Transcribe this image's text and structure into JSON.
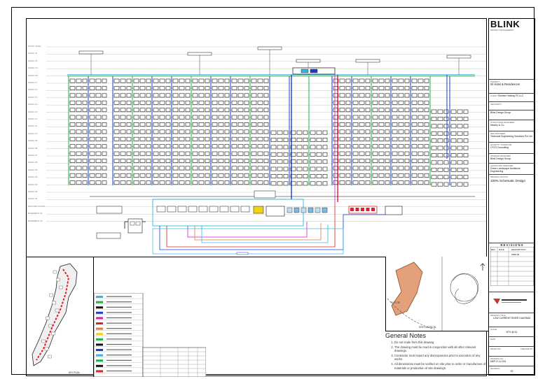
{
  "title_block": {
    "logo": "BLINK",
    "logo_sub": "PROJECT MANAGEMENT",
    "project_label": "PROJECT",
    "project_name": "W Hotel & Residences",
    "client_label": "CLIENT",
    "client_name": "Sunrise Holding FZ-LLC",
    "architect_label": "ARCHITECT",
    "architect_name": "Blink Design Group",
    "structural_label": "STRUCTURAL ENGINEER",
    "structural_name": "Nearby & Co.",
    "mep_label": "MEP ENGINEER",
    "mep_name": "Technical Engineering Solutions Pvt Ltd",
    "qs_label": "QUANTITY SURVEYOR",
    "qs_name": "LFCG Consulting",
    "interior_label": "INTERIOR DESIGNER",
    "interior_name": "Blink Design Group",
    "landscape_label": "LANDSCAPE DESIGNER",
    "landscape_name": "Green Landscape Architects Engineering",
    "status_label": "DRAWING STATUS",
    "status_value": "100% Schematic Design",
    "revisions_label": "R E V I S I O N S",
    "rev_headers": [
      "REV",
      "DATE",
      "DESCRIPTION"
    ],
    "rev_first": "PRELIM",
    "drawing_title_label": "DRAWING TITLE",
    "drawing_title": "LOW CURRENT RISER DIAGRAM",
    "scale_label": "SCALE",
    "scale_value": "NTS @ A1",
    "date_label": "DATE",
    "drawn_label": "DRAWN BY",
    "checked_label": "CHECKED BY",
    "drawing_no_label": "DRAWING NO.",
    "drawing_no": "MEP-E-LV-001",
    "rev_label": "REVISION",
    "rev_value": "00"
  },
  "key_plan": {
    "label": "KEY PLAN",
    "site_label": "SITE LOCATION",
    "plot_label": "PLOT 33"
  },
  "general_notes": {
    "title": "General Notes",
    "items": [
      "Do not scale from this drawing.",
      "The drawing must be read in conjunction with all other relevant drawings.",
      "Contractor must report any discrepancies prior to execution of any works.",
      "All dimensions must be verified on site prior to order or manufacture of materials or production of site drawings."
    ]
  },
  "floors": [
    "ROOF LEVEL",
    "LEVEL 21",
    "LEVEL 20",
    "LEVEL 19",
    "LEVEL 18",
    "LEVEL 17",
    "LEVEL 16",
    "LEVEL 15",
    "LEVEL 14",
    "LEVEL 13",
    "LEVEL 12",
    "LEVEL 11",
    "LEVEL 10",
    "LEVEL 09",
    "LEVEL 08",
    "LEVEL 07",
    "LEVEL 06",
    "LEVEL 05",
    "LEVEL 04",
    "LEVEL 03",
    "LEVEL 02",
    "LEVEL 01",
    "GROUND FLOOR",
    "BASEMENT 01",
    "BASEMENT 02"
  ],
  "colors": {
    "green": "#19b43a",
    "blue": "#1a3bd8",
    "cyan": "#2fb6e6",
    "red": "#e0202a",
    "magenta": "#d61bbf",
    "orange": "#e07b3a",
    "yellow": "#f0d21a"
  }
}
